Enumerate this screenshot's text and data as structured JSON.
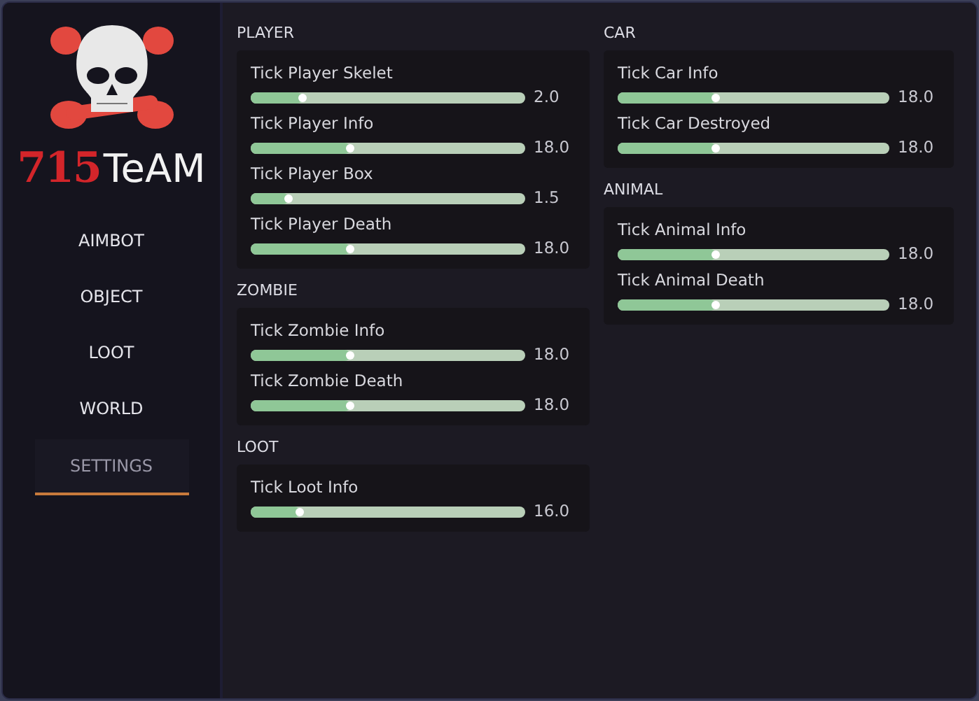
{
  "logo": {
    "number": "715",
    "word": "TeAM"
  },
  "nav": [
    {
      "label": "AIMBOT",
      "selected": false
    },
    {
      "label": "OBJECT",
      "selected": false
    },
    {
      "label": "LOOT",
      "selected": false
    },
    {
      "label": "WORLD",
      "selected": false
    },
    {
      "label": "SETTINGS",
      "selected": true
    }
  ],
  "columns": [
    [
      {
        "title": "PLAYER",
        "sliders": [
          {
            "label": "Tick Player Skelet",
            "level": 0.19,
            "reading": "2.0"
          },
          {
            "label": "Tick Player Info",
            "level": 0.36,
            "reading": "18.0"
          },
          {
            "label": "Tick Player Box",
            "level": 0.14,
            "reading": "1.5"
          },
          {
            "label": "Tick Player Death",
            "level": 0.36,
            "reading": "18.0"
          }
        ]
      },
      {
        "title": "ZOMBIE",
        "sliders": [
          {
            "label": "Tick Zombie Info",
            "level": 0.36,
            "reading": "18.0"
          },
          {
            "label": "Tick Zombie Death",
            "level": 0.36,
            "reading": "18.0"
          }
        ]
      },
      {
        "title": "LOOT",
        "sliders": [
          {
            "label": "Tick Loot Info",
            "level": 0.18,
            "reading": "16.0"
          }
        ]
      }
    ],
    [
      {
        "title": "CAR",
        "sliders": [
          {
            "label": "Tick Car Info",
            "level": 0.36,
            "reading": "18.0"
          },
          {
            "label": "Tick Car Destroyed",
            "level": 0.36,
            "reading": "18.0"
          }
        ]
      },
      {
        "title": "ANIMAL",
        "sliders": [
          {
            "label": "Tick Animal Info",
            "level": 0.36,
            "reading": "18.0"
          },
          {
            "label": "Tick Animal Death",
            "level": 0.36,
            "reading": "18.0"
          }
        ]
      }
    ]
  ]
}
